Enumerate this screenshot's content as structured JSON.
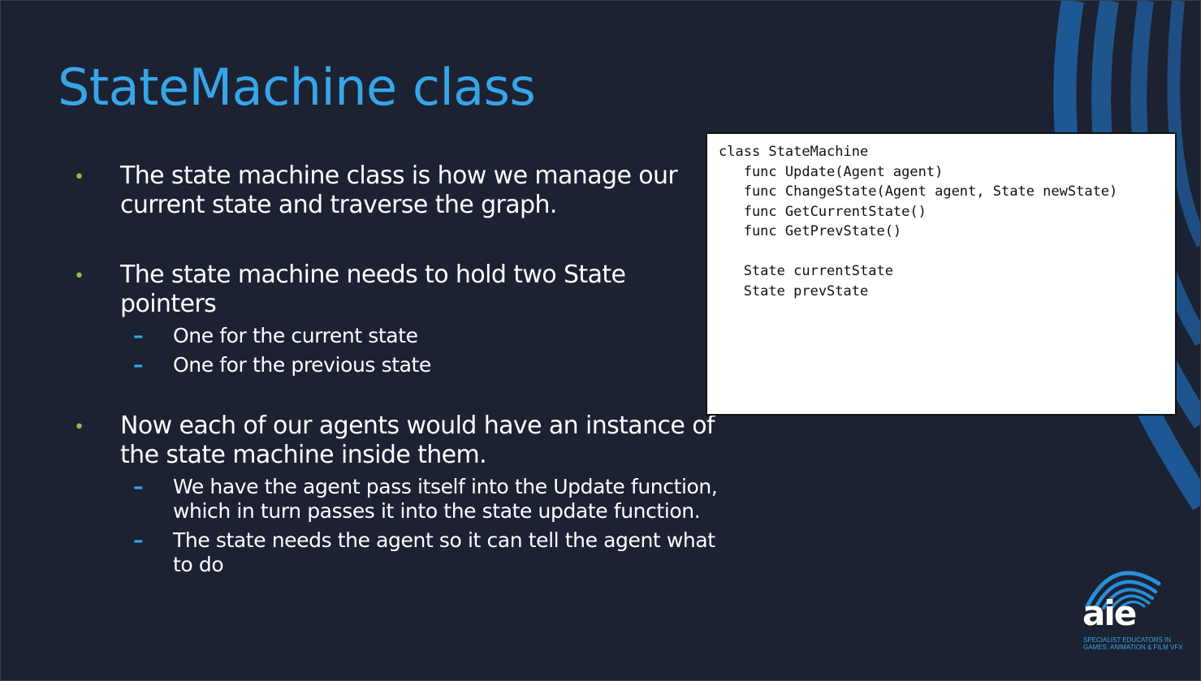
{
  "slide": {
    "title": "StateMachine class",
    "bullets": [
      {
        "text": "The state machine class is how we manage our current state and traverse the graph.",
        "subs": []
      },
      {
        "text": "The state machine needs to hold two State pointers",
        "subs": [
          "One for the current state",
          "One for the previous state"
        ]
      },
      {
        "text": "Now each of our agents would have an instance of the state machine inside them.",
        "subs": [
          "We have the agent pass itself into the Update function, which in turn passes it into the state update function.",
          "The state needs the agent so it can tell the agent what to do"
        ]
      }
    ],
    "bullet_glyph": "•",
    "sub_glyph": "–",
    "code": "class StateMachine\n   func Update(Agent agent)\n   func ChangeState(Agent agent, State newState)\n   func GetCurrentState()\n   func GetPrevState()\n\n   State currentState\n   State prevState",
    "logo": {
      "word": "aie",
      "tagline_line1": "SPECIALIST EDUCATORS IN",
      "tagline_line2": "GAMES, ANIMATION & FILM VFX"
    }
  },
  "colors": {
    "background": "#1c2232",
    "title": "#36a6e8",
    "bullet": "#8bc34a",
    "dash": "#36a6e8",
    "arcs": "#1f5e9e"
  }
}
